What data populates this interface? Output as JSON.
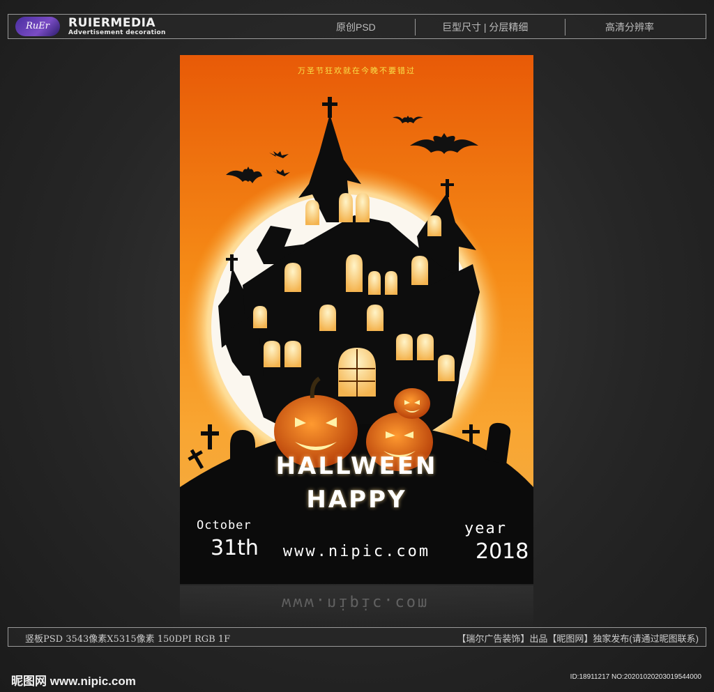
{
  "header": {
    "logo_text": "RuEr",
    "brand": "RUIERMEDIA",
    "brand_sub": "Advertisement decoration",
    "items": [
      "原创PSD",
      "巨型尺寸 | 分层精细",
      "高清分辨率"
    ]
  },
  "poster": {
    "tagline": "万圣节狂欢就在今晚不要错过",
    "title": "HALLWEEN",
    "subtitle": "HAPPY",
    "left_label": "October",
    "left_value": "31th",
    "right_label": "year",
    "right_value": "2018",
    "website": "www.nipic.com"
  },
  "footer": {
    "spec": "竖板PSD 3543像素X5315像素 150DPI RGB 1F",
    "credit": "【瑞尔广告装饰】出品【昵图网】独家发布(请通过昵图联系)",
    "site_logo": "昵图网 www.nipic.com",
    "id_line": "ID:18911217 NO:20201020203019544000"
  },
  "colors": {
    "sky_top": "#e85a07",
    "sky_bottom": "#f0b04a",
    "silhouette": "#0d0d0d",
    "window_glow": "#ffd98a",
    "pumpkin": "#e86a10"
  }
}
